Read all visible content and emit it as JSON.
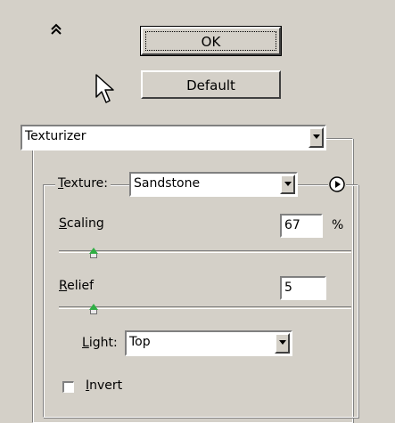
{
  "top": {
    "collapse_icon": "double-chevron-up",
    "cursor_icon": "arrow-pointer",
    "ok_label": "OK",
    "default_label": "Default"
  },
  "filter": {
    "selected": "Texturizer"
  },
  "texture": {
    "label_prefix": "",
    "label_mnemonic": "T",
    "label_rest": "exture:",
    "selected": "Sandstone",
    "menu_icon": "circle-right-arrow"
  },
  "scaling": {
    "label_mnemonic": "S",
    "label_rest": "caling",
    "value": "67",
    "unit": "%",
    "slider_fraction": 0.12
  },
  "relief": {
    "label_mnemonic": "R",
    "label_rest": "elief",
    "value": "5",
    "slider_fraction": 0.12
  },
  "light": {
    "label_mnemonic": "L",
    "label_rest": "ight:",
    "selected": "Top"
  },
  "invert": {
    "label_mnemonic": "I",
    "label_rest": "nvert",
    "checked": false
  }
}
